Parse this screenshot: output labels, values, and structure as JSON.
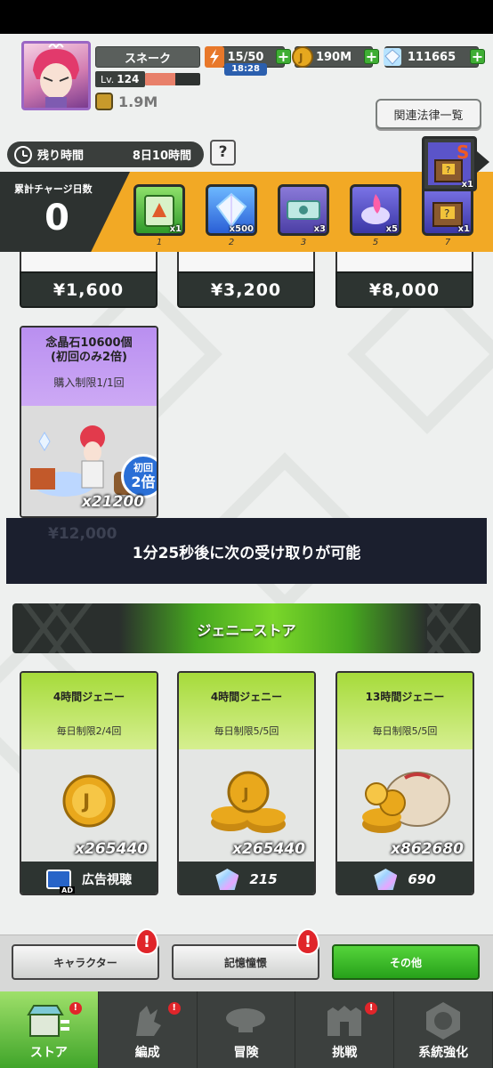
{
  "colors": {
    "accent_green": "#3fae34",
    "charge_band": "#f2a925",
    "dark_panel": "#2d3431",
    "crystal_purple": "#b98ff0",
    "jenny_green": "#a6db3a"
  },
  "header": {
    "player_name": "スネーク",
    "level_label": "Lv.",
    "level": "124",
    "exp_fraction": 0.55,
    "power": "1.9M",
    "stamina": "15/50",
    "stamina_timer": "18:28",
    "jenny": "190M",
    "crystals": "111665",
    "law_button": "関連法律一覧"
  },
  "remaining": {
    "label": "残り時間",
    "value": "8日10時間",
    "help": "?"
  },
  "charge": {
    "title": "累計チャージ日数",
    "days": "0",
    "rewards": [
      {
        "icon": "card-pack-icon",
        "qty": "x1",
        "day": "1"
      },
      {
        "icon": "crystal-icon",
        "qty": "x500",
        "day": "2"
      },
      {
        "icon": "ticket-icon",
        "qty": "x3",
        "day": "3"
      },
      {
        "icon": "summon-scroll-icon",
        "qty": "x5",
        "day": "5"
      },
      {
        "icon": "mystery-box-icon",
        "qty": "x1",
        "day": "7"
      }
    ],
    "special_reward": {
      "icon": "s-rank-box-icon",
      "badge": "S",
      "qty": "x1"
    }
  },
  "prices": [
    "¥1,600",
    "¥3,200",
    "¥8,000"
  ],
  "crystal_offer": {
    "title_line1": "念晶石10600個",
    "title_line2": "(初回のみ2倍)",
    "limit": "購入制限1/1回",
    "badge_top": "初回",
    "badge_bottom": "2倍",
    "qty": "x21200",
    "price_hidden": "¥12,000"
  },
  "toast": "1分25秒後に次の受け取りが可能",
  "jenny_store": {
    "title": "ジェニーストア",
    "items": [
      {
        "name": "4時間ジェニー",
        "limit": "毎日制限2/4回",
        "qty": "x265440",
        "cost_label": "広告視聴",
        "cost_icon": "ad-video-icon"
      },
      {
        "name": "4時間ジェニー",
        "limit": "毎日制限5/5回",
        "qty": "x265440",
        "cost_label": "215",
        "cost_icon": "gem-icon"
      },
      {
        "name": "13時間ジェニー",
        "limit": "毎日制限5/5回",
        "qty": "x862680",
        "cost_label": "690",
        "cost_icon": "gem-icon"
      }
    ]
  },
  "subtabs": [
    {
      "label": "キャラクター",
      "alert": "!"
    },
    {
      "label": "記憶憧憬",
      "alert": "!"
    },
    {
      "label": "その他",
      "alert": ""
    }
  ],
  "nav": [
    {
      "label": "ストア",
      "icon": "store-icon",
      "active": true,
      "dot": "!"
    },
    {
      "label": "編成",
      "icon": "formation-icon",
      "active": false,
      "dot": "!"
    },
    {
      "label": "冒険",
      "icon": "airship-icon",
      "active": false,
      "dot": ""
    },
    {
      "label": "挑戦",
      "icon": "arena-icon",
      "active": false,
      "dot": "!"
    },
    {
      "label": "系統強化",
      "icon": "nen-system-icon",
      "active": false,
      "dot": ""
    }
  ]
}
